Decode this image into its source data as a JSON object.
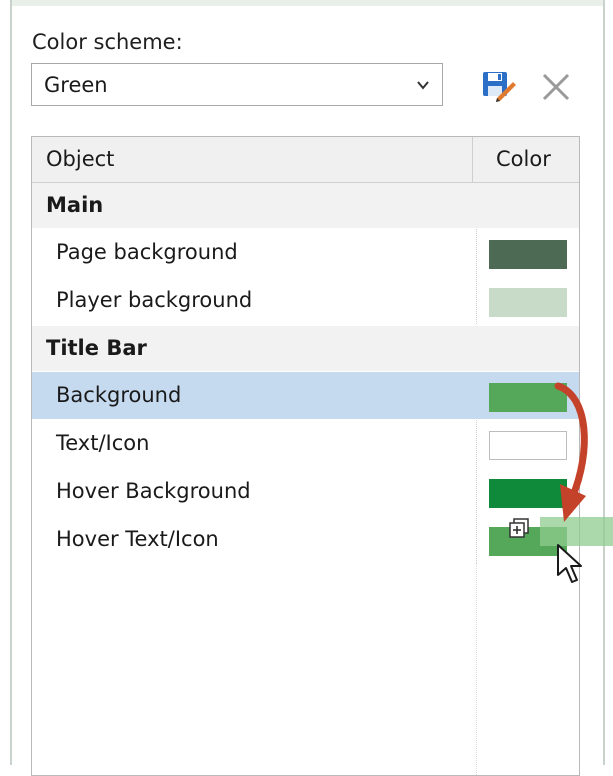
{
  "scheme": {
    "label": "Color scheme:",
    "value": "Green"
  },
  "table": {
    "headers": {
      "object": "Object",
      "color": "Color"
    },
    "groups": [
      {
        "label": "Main",
        "rows": [
          {
            "label": "Page background",
            "color": "#4d6a55"
          },
          {
            "label": "Player background",
            "color": "#c8dbc8"
          }
        ]
      },
      {
        "label": "Title Bar",
        "rows": [
          {
            "label": "Background",
            "color": "#55a85a",
            "selected": true
          },
          {
            "label": "Text/Icon",
            "color": "#ffffff"
          },
          {
            "label": "Hover Background",
            "color": "#0f8a3a"
          },
          {
            "label": "Hover Text/Icon",
            "color": "#55a85a"
          }
        ]
      }
    ]
  },
  "colors": {
    "accent_selection": "#c5d9ef",
    "drag_arrow": "#c4422a",
    "save_icon_blue": "#2b6fc7"
  },
  "icons": {
    "dropdown": "chevron-down-icon",
    "save": "save-edit-icon",
    "close": "close-icon",
    "drag_copy": "copy-plus-icon",
    "cursor": "mouse-pointer-icon"
  }
}
